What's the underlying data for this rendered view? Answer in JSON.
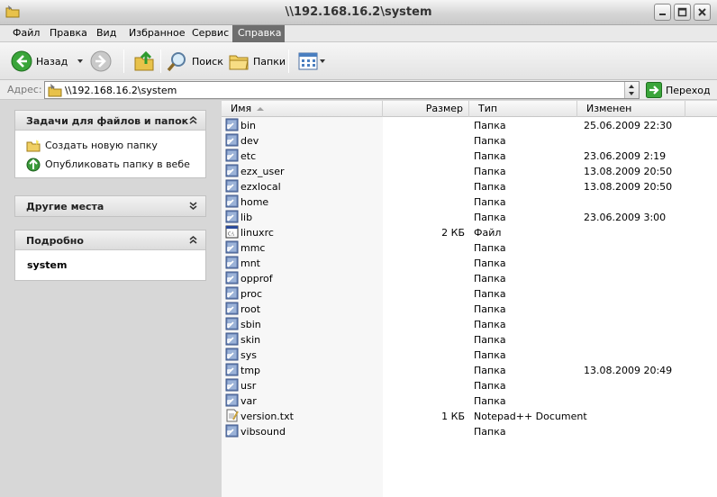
{
  "window": {
    "title": "\\\\192.168.16.2\\system",
    "app_icon": "folder-explorer-icon",
    "buttons": [
      "minimize-icon",
      "maximize-icon",
      "close-icon"
    ]
  },
  "menu": [
    "Файл",
    "Правка",
    "Вид",
    "Избранное",
    "Сервис",
    "Справка"
  ],
  "menu_active": "Справка",
  "toolbar": {
    "back_label": "Назад",
    "search_label": "Поиск",
    "folders_label": "Папки"
  },
  "address": {
    "label": "Адрес:",
    "value": "\\\\192.168.16.2\\system",
    "go_label": "Переход"
  },
  "left_pane": {
    "tasks_title": "Задачи для файлов и папок",
    "tasks": [
      {
        "label": "Создать новую папку",
        "icon": "new-folder-icon"
      },
      {
        "label": "Опубликовать папку в вебе",
        "icon": "publish-web-icon"
      }
    ],
    "other_title": "Другие места",
    "details_title": "Подробно",
    "details_name": "system"
  },
  "columns": {
    "name": "Имя",
    "size": "Размер",
    "type": "Тип",
    "modified": "Изменен"
  },
  "files": [
    {
      "name": "bin",
      "size": "",
      "type": "Папка",
      "modified": "25.06.2009 22:30",
      "icon": "folder-shortcut"
    },
    {
      "name": "dev",
      "size": "",
      "type": "Папка",
      "modified": "",
      "icon": "folder-shortcut"
    },
    {
      "name": "etc",
      "size": "",
      "type": "Папка",
      "modified": "23.06.2009 2:19",
      "icon": "folder-shortcut"
    },
    {
      "name": "ezx_user",
      "size": "",
      "type": "Папка",
      "modified": "13.08.2009 20:50",
      "icon": "folder-shortcut"
    },
    {
      "name": "ezxlocal",
      "size": "",
      "type": "Папка",
      "modified": "13.08.2009 20:50",
      "icon": "folder-shortcut"
    },
    {
      "name": "home",
      "size": "",
      "type": "Папка",
      "modified": "",
      "icon": "folder-shortcut"
    },
    {
      "name": "lib",
      "size": "",
      "type": "Папка",
      "modified": "23.06.2009 3:00",
      "icon": "folder-shortcut"
    },
    {
      "name": "linuxrc",
      "size": "2 КБ",
      "type": "Файл",
      "modified": "",
      "icon": "file"
    },
    {
      "name": "mmc",
      "size": "",
      "type": "Папка",
      "modified": "",
      "icon": "folder-shortcut"
    },
    {
      "name": "mnt",
      "size": "",
      "type": "Папка",
      "modified": "",
      "icon": "folder-shortcut"
    },
    {
      "name": "opprof",
      "size": "",
      "type": "Папка",
      "modified": "",
      "icon": "folder-shortcut"
    },
    {
      "name": "proc",
      "size": "",
      "type": "Папка",
      "modified": "",
      "icon": "folder-shortcut"
    },
    {
      "name": "root",
      "size": "",
      "type": "Папка",
      "modified": "",
      "icon": "folder-shortcut"
    },
    {
      "name": "sbin",
      "size": "",
      "type": "Папка",
      "modified": "",
      "icon": "folder-shortcut"
    },
    {
      "name": "skin",
      "size": "",
      "type": "Папка",
      "modified": "",
      "icon": "folder-shortcut"
    },
    {
      "name": "sys",
      "size": "",
      "type": "Папка",
      "modified": "",
      "icon": "folder-shortcut"
    },
    {
      "name": "tmp",
      "size": "",
      "type": "Папка",
      "modified": "13.08.2009 20:49",
      "icon": "folder-shortcut"
    },
    {
      "name": "usr",
      "size": "",
      "type": "Папка",
      "modified": "",
      "icon": "folder-shortcut"
    },
    {
      "name": "var",
      "size": "",
      "type": "Папка",
      "modified": "",
      "icon": "folder-shortcut"
    },
    {
      "name": "version.txt",
      "size": "1 КБ",
      "type": "Notepad++ Document",
      "modified": "",
      "icon": "text-document"
    },
    {
      "name": "vibsound",
      "size": "",
      "type": "Папка",
      "modified": "",
      "icon": "folder-shortcut"
    }
  ]
}
